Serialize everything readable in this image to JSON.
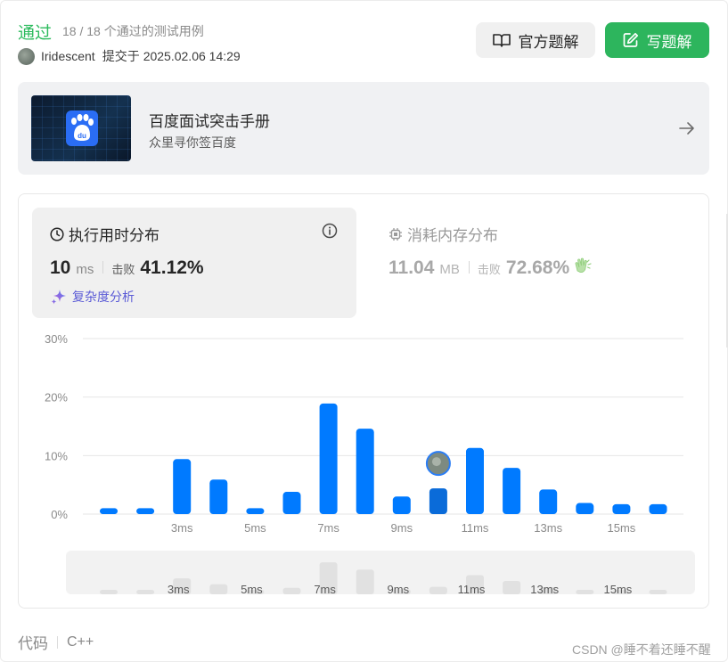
{
  "header": {
    "status": "通过",
    "testcases": "18 / 18 个通过的测试用例",
    "username": "Iridescent",
    "submitted_label": "提交于",
    "submitted_time": "2025.02.06 14:29",
    "official_solution_label": "官方题解",
    "write_solution_label": "写题解"
  },
  "promo": {
    "title": "百度面试突击手册",
    "subtitle": "众里寻你签百度",
    "icon": "baidu-paw-icon"
  },
  "runtime": {
    "title": "执行用时分布",
    "value": "10",
    "unit": "ms",
    "beat_label": "击败",
    "percent": "41.12%",
    "complexity_label": "复杂度分析"
  },
  "memory": {
    "title": "消耗内存分布",
    "value": "11.04",
    "unit": "MB",
    "beat_label": "击败",
    "percent": "72.68%"
  },
  "chart_data": {
    "type": "bar",
    "ytick_labels": [
      "30%",
      "20%",
      "10%",
      "0%"
    ],
    "ylim": [
      0,
      30
    ],
    "grid": true,
    "xtick_labels": [
      "3ms",
      "5ms",
      "7ms",
      "9ms",
      "11ms",
      "13ms",
      "15ms"
    ],
    "values": [
      1.0,
      1.0,
      9.4,
      5.9,
      1.0,
      3.8,
      18.9,
      14.6,
      3.0,
      4.4,
      11.3,
      7.9,
      4.2,
      1.9,
      1.7,
      1.7
    ],
    "highlight_index": 9,
    "colors": {
      "bar": "#007aff",
      "highlight": "#0a6bd9",
      "grid": "#e6e6e6",
      "minimap_bar": "#e1e1e1"
    }
  },
  "footer": {
    "code_label": "代码",
    "language": "C++",
    "watermark": "CSDN @睡不着还睡不醒"
  }
}
